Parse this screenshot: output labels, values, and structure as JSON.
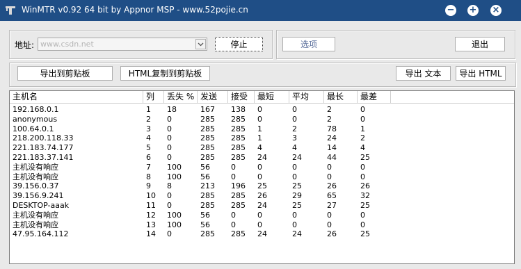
{
  "window": {
    "title": "WinMTR v0.92 64 bit by Appnor MSP - www.52pojie.cn",
    "minimize_glyph": "−",
    "maximize_glyph": "+",
    "close_glyph": "×"
  },
  "controls": {
    "address_label": "地址:",
    "address_value": "www.csdn.net",
    "stop_label": "停止",
    "options_label": "选项",
    "exit_label": "退出",
    "export_clipboard_label": "导出到剪贴板",
    "html_clipboard_label": "HTML复制到剪贴板",
    "export_text_label": "导出 文本",
    "export_html_label": "导出 HTML"
  },
  "table": {
    "columns": [
      "主机名",
      "列",
      "丢失 %",
      "发送",
      "接受",
      "最短",
      "平均",
      "最长",
      "最差"
    ],
    "rows": [
      [
        "192.168.0.1",
        "1",
        "18",
        "167",
        "138",
        "0",
        "0",
        "2",
        "0"
      ],
      [
        "anonymous",
        "2",
        "0",
        "285",
        "285",
        "0",
        "0",
        "2",
        "0"
      ],
      [
        "100.64.0.1",
        "3",
        "0",
        "285",
        "285",
        "1",
        "2",
        "78",
        "1"
      ],
      [
        "218.200.118.33",
        "4",
        "0",
        "285",
        "285",
        "1",
        "3",
        "24",
        "2"
      ],
      [
        "221.183.74.177",
        "5",
        "0",
        "285",
        "285",
        "4",
        "4",
        "14",
        "4"
      ],
      [
        "221.183.37.141",
        "6",
        "0",
        "285",
        "285",
        "24",
        "24",
        "44",
        "25"
      ],
      [
        "主机没有响应",
        "7",
        "100",
        "56",
        "0",
        "0",
        "0",
        "0",
        "0"
      ],
      [
        "主机没有响应",
        "8",
        "100",
        "56",
        "0",
        "0",
        "0",
        "0",
        "0"
      ],
      [
        "39.156.0.37",
        "9",
        "8",
        "213",
        "196",
        "25",
        "25",
        "26",
        "26"
      ],
      [
        "39.156.9.241",
        "10",
        "0",
        "285",
        "285",
        "26",
        "29",
        "65",
        "32"
      ],
      [
        "DESKTOP-aaak",
        "11",
        "0",
        "285",
        "285",
        "24",
        "25",
        "27",
        "25"
      ],
      [
        "主机没有响应",
        "12",
        "100",
        "56",
        "0",
        "0",
        "0",
        "0",
        "0"
      ],
      [
        "主机没有响应",
        "13",
        "100",
        "56",
        "0",
        "0",
        "0",
        "0",
        "0"
      ],
      [
        "47.95.164.112",
        "14",
        "0",
        "285",
        "285",
        "24",
        "24",
        "26",
        "25"
      ]
    ]
  }
}
